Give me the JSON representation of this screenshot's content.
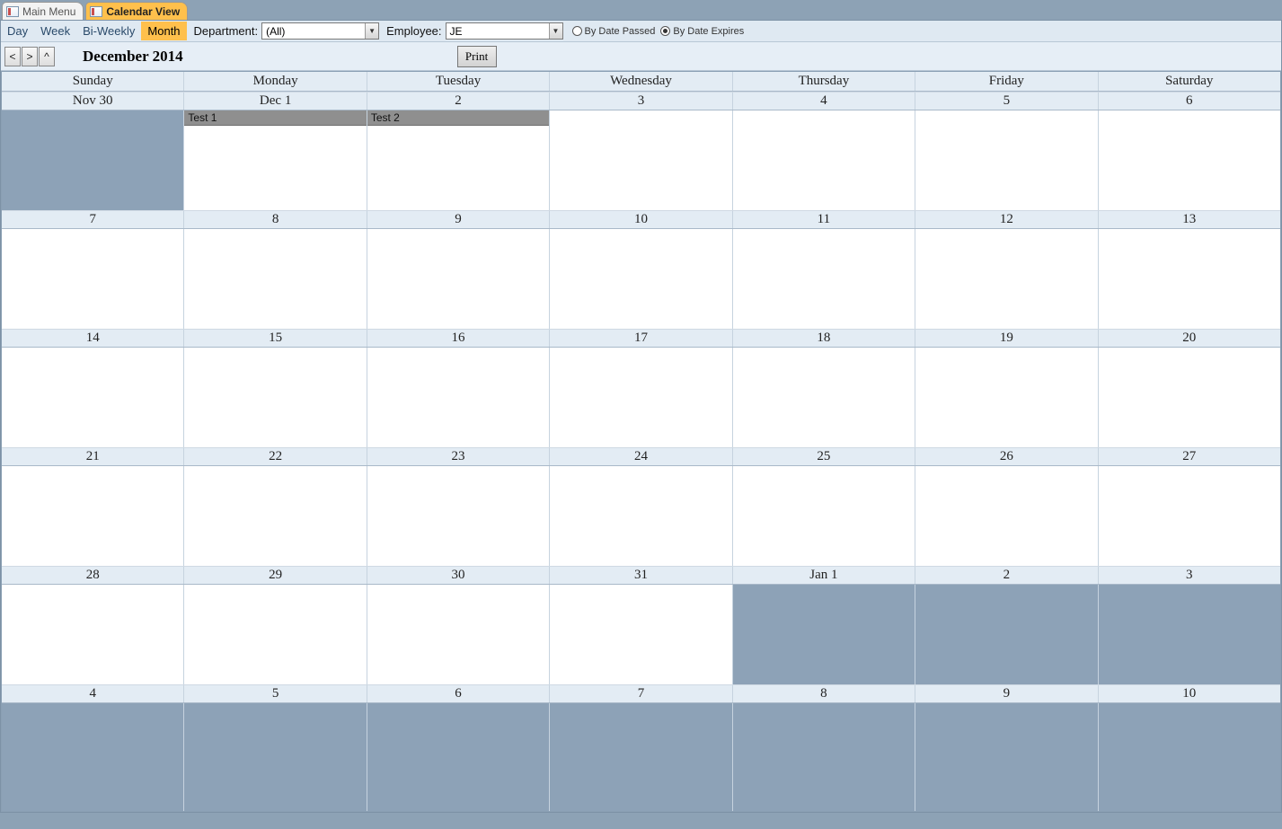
{
  "tabs": {
    "main_menu": "Main Menu",
    "calendar_view": "Calendar View"
  },
  "toolbar": {
    "views": {
      "day": "Day",
      "week": "Week",
      "biweekly": "Bi-Weekly",
      "month": "Month"
    },
    "department_label": "Department:",
    "department_value": "(All)",
    "employee_label": "Employee:",
    "employee_value": "JE",
    "radio_passed": "By Date Passed",
    "radio_expires": "By Date Expires"
  },
  "nav": {
    "prev": "<",
    "next": ">",
    "up": "^",
    "month_title": "December 2014",
    "print": "Print"
  },
  "weekdays": [
    "Sunday",
    "Monday",
    "Tuesday",
    "Wednesday",
    "Thursday",
    "Friday",
    "Saturday"
  ],
  "weeks": [
    {
      "dates": [
        "Nov 30",
        "Dec 1",
        "2",
        "3",
        "4",
        "5",
        "6"
      ],
      "out": [
        true,
        false,
        false,
        false,
        false,
        false,
        false
      ],
      "events": [
        null,
        "Test 1",
        "Test 2",
        null,
        null,
        null,
        null
      ]
    },
    {
      "dates": [
        "7",
        "8",
        "9",
        "10",
        "11",
        "12",
        "13"
      ],
      "out": [
        false,
        false,
        false,
        false,
        false,
        false,
        false
      ],
      "events": [
        null,
        null,
        null,
        null,
        null,
        null,
        null
      ]
    },
    {
      "dates": [
        "14",
        "15",
        "16",
        "17",
        "18",
        "19",
        "20"
      ],
      "out": [
        false,
        false,
        false,
        false,
        false,
        false,
        false
      ],
      "events": [
        null,
        null,
        null,
        null,
        null,
        null,
        null
      ]
    },
    {
      "dates": [
        "21",
        "22",
        "23",
        "24",
        "25",
        "26",
        "27"
      ],
      "out": [
        false,
        false,
        false,
        false,
        false,
        false,
        false
      ],
      "events": [
        null,
        null,
        null,
        null,
        null,
        null,
        null
      ]
    },
    {
      "dates": [
        "28",
        "29",
        "30",
        "31",
        "Jan 1",
        "2",
        "3"
      ],
      "out": [
        false,
        false,
        false,
        false,
        true,
        true,
        true
      ],
      "events": [
        null,
        null,
        null,
        null,
        null,
        null,
        null
      ]
    },
    {
      "dates": [
        "4",
        "5",
        "6",
        "7",
        "8",
        "9",
        "10"
      ],
      "out": [
        true,
        true,
        true,
        true,
        true,
        true,
        true
      ],
      "events": [
        null,
        null,
        null,
        null,
        null,
        null,
        null
      ]
    }
  ]
}
